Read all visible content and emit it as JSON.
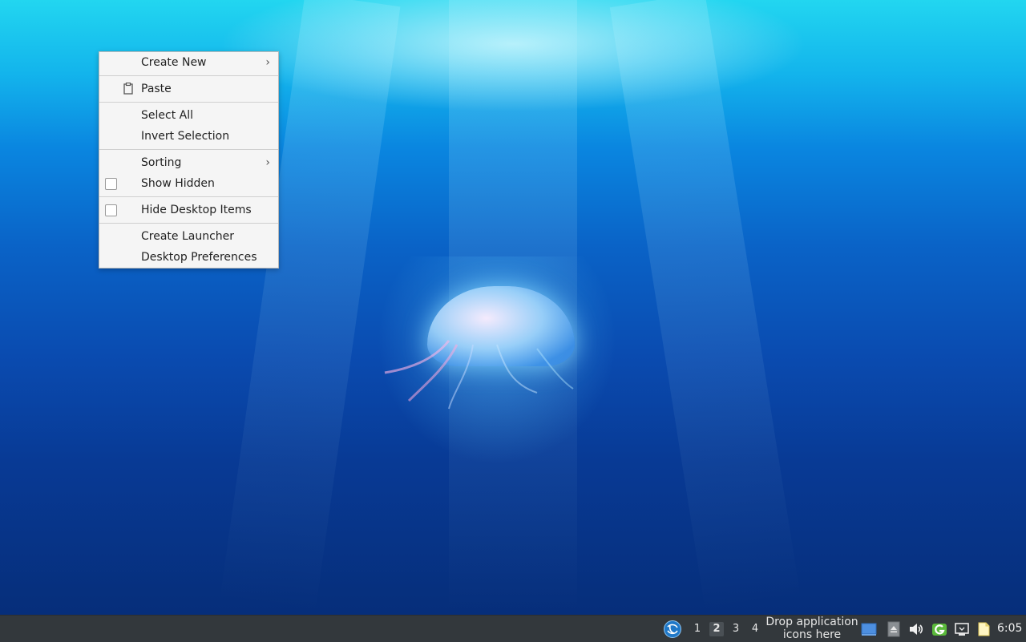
{
  "context_menu": {
    "items": [
      {
        "label": "Create New",
        "submenu": true
      },
      {
        "label": "Paste",
        "icon": "clipboard-icon"
      },
      {
        "label": "Select All"
      },
      {
        "label": "Invert Selection"
      },
      {
        "label": "Sorting",
        "submenu": true
      },
      {
        "label": "Show Hidden",
        "checkbox": true,
        "checked": false
      },
      {
        "label": "Hide Desktop Items",
        "checkbox": true,
        "checked": false
      },
      {
        "label": "Create Launcher"
      },
      {
        "label": "Desktop Preferences"
      }
    ],
    "submenu_arrow": "›"
  },
  "taskbar": {
    "desktops": [
      "1",
      "2",
      "3",
      "4"
    ],
    "active_desktop": "2",
    "launcher_hint_line1": "Drop application",
    "launcher_hint_line2": "icons here",
    "clock": "6:05",
    "tray_icons": [
      "show-desktop-icon",
      "eject-icon",
      "volume-icon",
      "update-manager-icon",
      "network-icon",
      "clipboard-manager-icon"
    ]
  },
  "colors": {
    "taskbar_bg": "#33383c",
    "menu_bg": "#f5f5f5",
    "wallpaper_top": "#22d6f0",
    "wallpaper_bottom": "#062e7a"
  }
}
